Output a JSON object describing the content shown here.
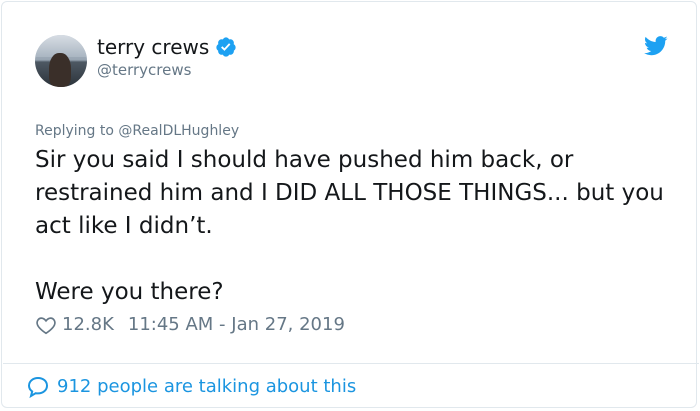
{
  "user": {
    "name": "terry crews",
    "handle": "@terrycrews",
    "avatar_icon": "profile-photo",
    "verified_icon": "verified-badge-icon",
    "verified_color": "#1da1f2"
  },
  "brand": {
    "icon": "twitter-bird-icon",
    "color": "#1da1f2"
  },
  "reply": {
    "prefix": "Replying to",
    "mention": "@RealDLHughley"
  },
  "tweet": {
    "paragraph1": "Sir you said I should have pushed him back, or restrained him and I DID ALL THOSE THINGS... but you act like I didn’t.",
    "paragraph2": "Were you there?"
  },
  "meta": {
    "like_icon": "heart-icon",
    "likes": "12.8K",
    "timestamp": "11:45 AM - Jan 27, 2019"
  },
  "footer": {
    "icon": "speech-bubble-icon",
    "text": "912 people are talking about this",
    "color": "#1b95e0"
  }
}
